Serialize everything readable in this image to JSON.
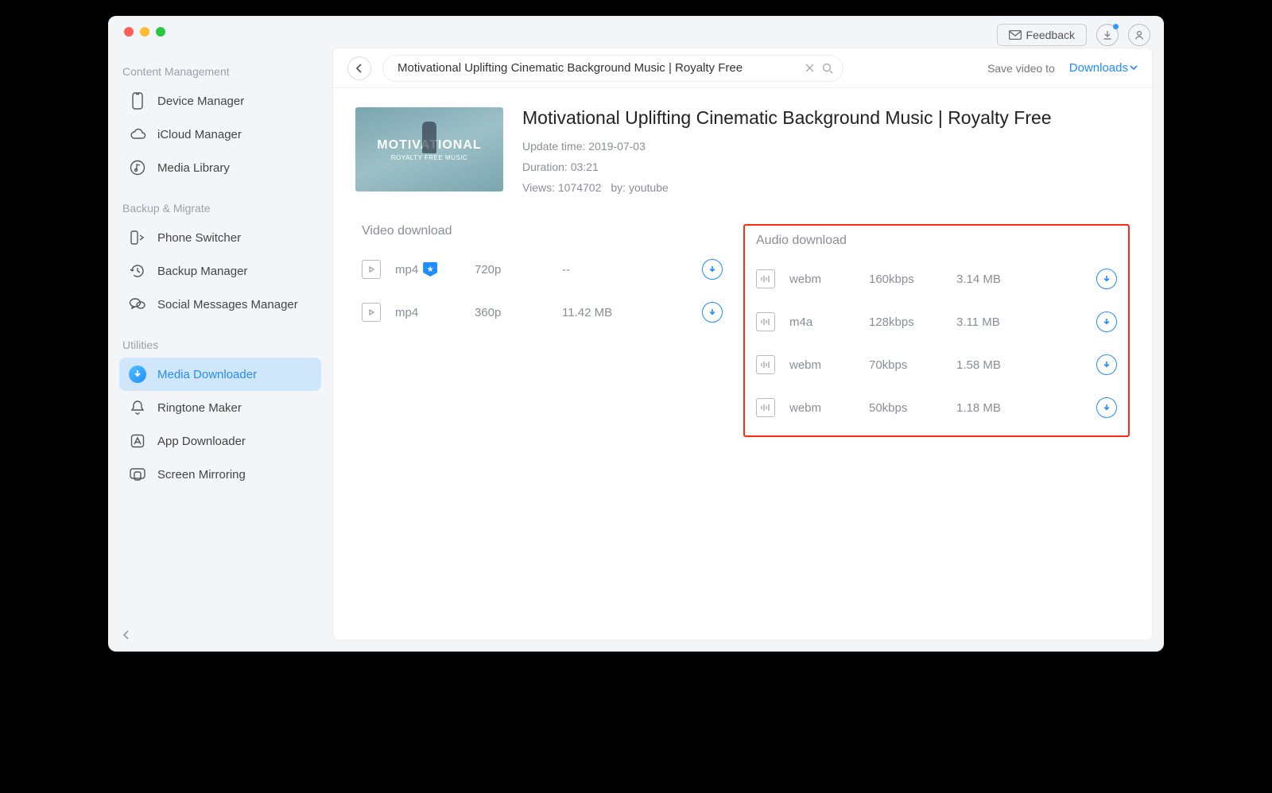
{
  "header": {
    "feedback_label": "Feedback"
  },
  "sidebar": {
    "sections": [
      {
        "title": "Content Management",
        "items": [
          {
            "label": "Device Manager"
          },
          {
            "label": "iCloud Manager"
          },
          {
            "label": "Media Library"
          }
        ]
      },
      {
        "title": "Backup & Migrate",
        "items": [
          {
            "label": "Phone Switcher"
          },
          {
            "label": "Backup Manager"
          },
          {
            "label": "Social Messages Manager"
          }
        ]
      },
      {
        "title": "Utilities",
        "items": [
          {
            "label": "Media Downloader"
          },
          {
            "label": "Ringtone Maker"
          },
          {
            "label": "App Downloader"
          },
          {
            "label": "Screen Mirroring"
          }
        ]
      }
    ],
    "active": "Media Downloader"
  },
  "mainbar": {
    "search_value": "Motivational Uplifting Cinematic Background Music | Royalty Free",
    "save_label": "Save video to",
    "dest_label": "Downloads"
  },
  "detail": {
    "title": "Motivational Uplifting Cinematic Background Music | Royalty Free",
    "thumb_line1": "MOTIVATIONAL",
    "thumb_line2": "ROYALTY FREE MUSIC",
    "update_label": "Update time: ",
    "update_value": "2019-07-03",
    "duration_label": "Duration: ",
    "duration_value": "03:21",
    "views_label": "Views: ",
    "views_value": "1074702",
    "by_label": "by: ",
    "by_value": "youtube"
  },
  "video_section_title": "Video download",
  "audio_section_title": "Audio download",
  "video_rows": [
    {
      "format": "mp4",
      "starred": true,
      "quality": "720p",
      "size": "--"
    },
    {
      "format": "mp4",
      "starred": false,
      "quality": "360p",
      "size": "11.42 MB"
    }
  ],
  "audio_rows": [
    {
      "format": "webm",
      "quality": "160kbps",
      "size": "3.14 MB"
    },
    {
      "format": "m4a",
      "quality": "128kbps",
      "size": "3.11 MB"
    },
    {
      "format": "webm",
      "quality": "70kbps",
      "size": "1.58 MB"
    },
    {
      "format": "webm",
      "quality": "50kbps",
      "size": "1.18 MB"
    }
  ]
}
